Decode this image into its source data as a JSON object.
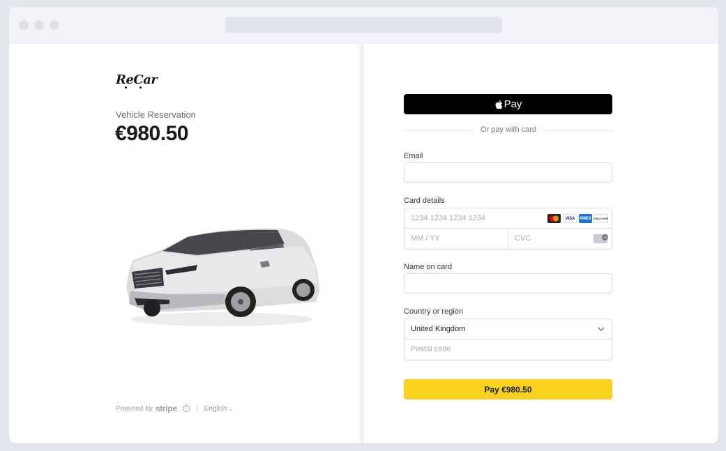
{
  "merchant": {
    "logo_text": "ReCar"
  },
  "product": {
    "label": "Vehicle Reservation",
    "price": "€980.50"
  },
  "footer": {
    "powered_by": "Powered by",
    "brand": "stripe",
    "info": "i",
    "language": "English",
    "language_chevron": "⌄"
  },
  "payment": {
    "apple_pay_label": "Pay",
    "divider_text": "Or pay with card",
    "email": {
      "label": "Email",
      "value": ""
    },
    "card": {
      "label": "Card details",
      "number_placeholder": "1234 1234 1234 1234",
      "expiry_placeholder": "MM / YY",
      "cvc_placeholder": "CVC",
      "brands": [
        "mastercard-icon",
        "VISA",
        "AMEX",
        "DISCOVER"
      ],
      "cvc_badge": "135"
    },
    "name": {
      "label": "Name on card",
      "value": ""
    },
    "country": {
      "label": "Country or region",
      "selected": "United Kingdom",
      "postal_placeholder": "Postal code"
    },
    "pay_button": "Pay €980.50"
  },
  "colors": {
    "pay_button": "#f8d21c",
    "apple_pay": "#000000",
    "background": "#e4e7ee"
  }
}
